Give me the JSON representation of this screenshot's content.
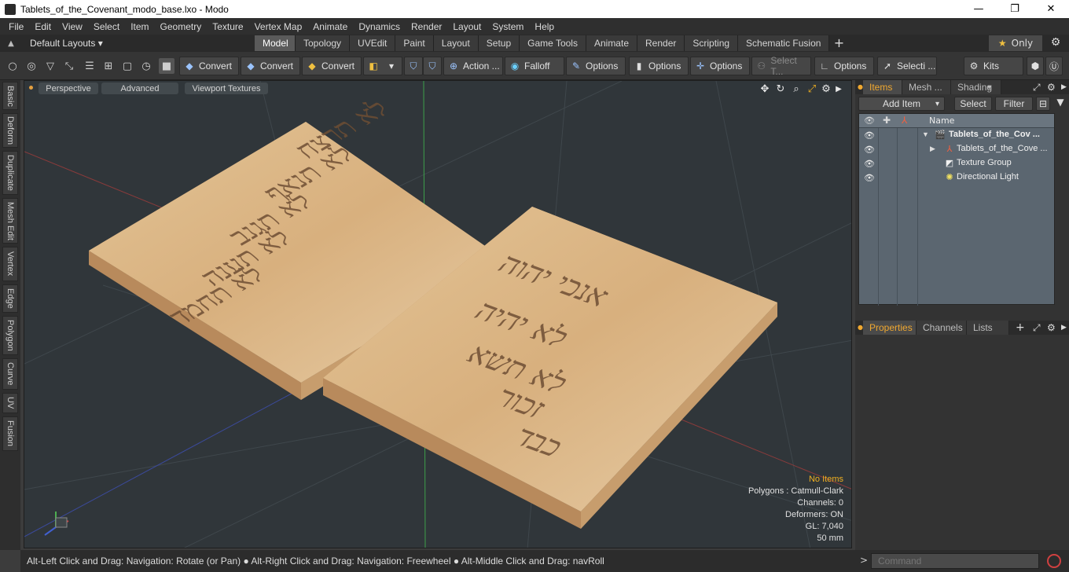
{
  "window": {
    "title": "Tablets_of_the_Covenant_modo_base.lxo - Modo",
    "minimize": "—",
    "maximize": "❐",
    "close": "✕"
  },
  "menu": [
    "File",
    "Edit",
    "View",
    "Select",
    "Item",
    "Geometry",
    "Texture",
    "Vertex Map",
    "Animate",
    "Dynamics",
    "Render",
    "Layout",
    "System",
    "Help"
  ],
  "layouts": {
    "dropdown": "Default Layouts ▾",
    "tabs": [
      "Model",
      "Topology",
      "UVEdit",
      "Paint",
      "Layout",
      "Setup",
      "Game Tools",
      "Animate",
      "Render",
      "Scripting",
      "Schematic Fusion"
    ],
    "active_tab": "Model",
    "add": "+",
    "only_label": "Only",
    "star": "★",
    "gear": "⚙"
  },
  "toolbar": {
    "convert1": "Convert",
    "convert2": "Convert",
    "convert3": "Convert",
    "action": "Action ...",
    "falloff": "Falloff",
    "options1": "Options",
    "options2": "Options",
    "options3": "Options",
    "select_t": "Select T...",
    "options4": "Options",
    "selecti": "Selecti ...",
    "kits": "Kits"
  },
  "left_tabs": [
    "Basic",
    "Deform",
    "Duplicate",
    "Mesh Edit",
    "Vertex",
    "Edge",
    "Polygon",
    "Curve",
    "UV",
    "Fusion"
  ],
  "viewport": {
    "perspective": "Perspective",
    "advanced": "Advanced",
    "textures": "Viewport Textures",
    "info": {
      "no_items": "No Items",
      "polygons": "Polygons : Catmull-Clark",
      "channels": "Channels: 0",
      "deformers": "Deformers: ON",
      "gl": "GL: 7,040",
      "mm": "50 mm"
    },
    "tablet_left_text": [
      "לא תרצח",
      "לא תנאף",
      "לא תגנב",
      "לא תענה",
      "לא תחמד"
    ],
    "tablet_right_text": [
      "אנכי יהוה",
      "לא יהיה",
      "לא תשא",
      "זכור",
      "כבד"
    ]
  },
  "items_panel": {
    "tabs": [
      "Items",
      "Mesh ...",
      "Shading"
    ],
    "active_tab": "Items",
    "add_item": "Add Item",
    "select": "Select",
    "filter": "Filter",
    "name_header": "Name",
    "rows": [
      {
        "label": "Tablets_of_the_Cov ...",
        "bold": true,
        "indent": 0
      },
      {
        "label": "Tablets_of_the_Cove ...",
        "bold": false,
        "indent": 1
      },
      {
        "label": "Texture Group",
        "bold": false,
        "indent": 1
      },
      {
        "label": "Directional Light",
        "bold": false,
        "indent": 1
      }
    ]
  },
  "props_panel": {
    "tabs": [
      "Properties",
      "Channels",
      "Lists"
    ],
    "active_tab": "Properties",
    "add": "+"
  },
  "status": {
    "text": "Alt-Left Click and Drag: Navigation: Rotate (or Pan) ● Alt-Right Click and Drag: Navigation: Freewheel ● Alt-Middle Click and Drag: navRoll"
  },
  "command": {
    "placeholder": "Command",
    "chevron": ">"
  }
}
